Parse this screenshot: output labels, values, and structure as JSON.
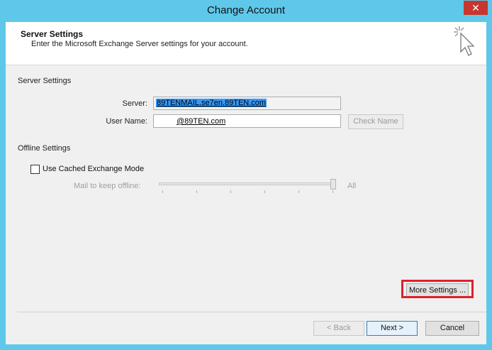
{
  "window": {
    "title": "Change Account",
    "close_label": "✕"
  },
  "header": {
    "title": "Server Settings",
    "subtitle": "Enter the Microsoft Exchange Server settings for your account.",
    "icon": "cursor-click-icon"
  },
  "server_section": {
    "label": "Server Settings",
    "server_label": "Server:",
    "server_value": "89TENMAIL.se7en.89TEN.com",
    "username_label": "User Name:",
    "username_value": "@89TEN.com",
    "check_name_label": "Check Name"
  },
  "offline_section": {
    "label": "Offline Settings",
    "cached_mode_label": "Use Cached Exchange Mode",
    "cached_mode_checked": false,
    "slider_label": "Mail to keep offline:",
    "slider_value_label": "All",
    "slider_level": 1.0
  },
  "buttons": {
    "more_settings": "More Settings ...",
    "back": "< Back",
    "next": "Next >",
    "cancel": "Cancel"
  },
  "colors": {
    "highlight": "#e0202a",
    "titlebar": "#5fc8ea",
    "selection": "#3399ff"
  }
}
